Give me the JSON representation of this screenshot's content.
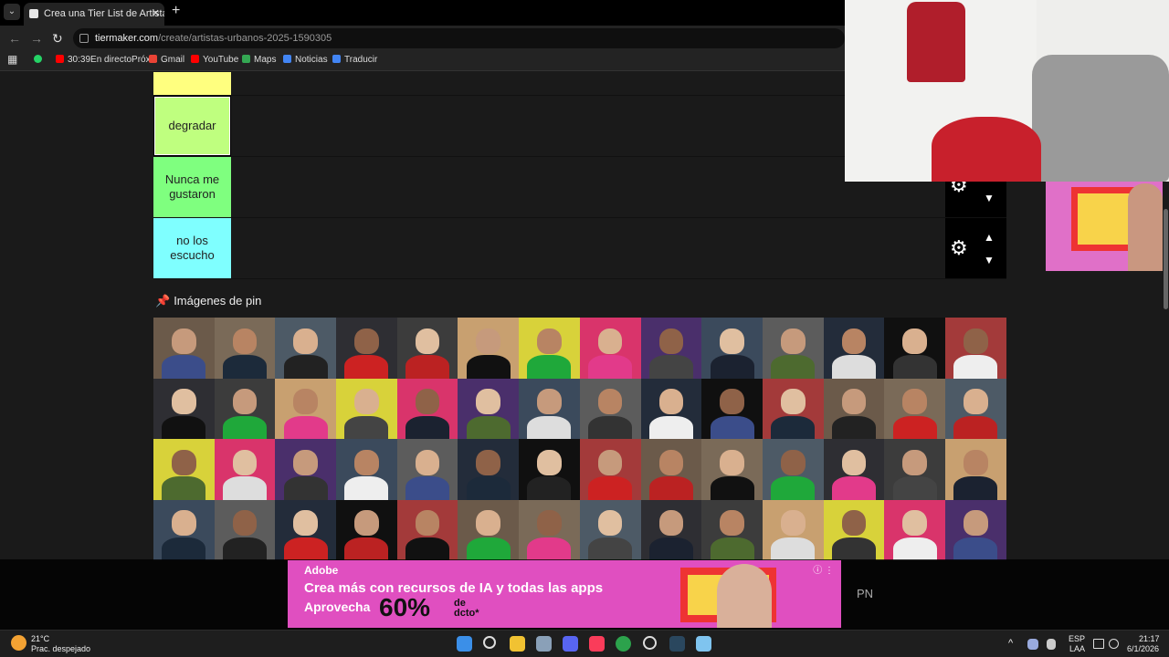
{
  "browser": {
    "tab_title": "Crea una Tier List de Artistas U",
    "tab_close": "✕",
    "new_tab": "+",
    "url_host": "tiermaker.com",
    "url_path": "/create/artistas-urbanos-2025-1590305",
    "bookmarks": [
      {
        "label": "",
        "color": "#25d366",
        "icon": "whatsapp-icon"
      },
      {
        "label": "30:39En directoPróx...",
        "color": "#ff0000",
        "icon": "youtube-icon"
      },
      {
        "label": "Gmail",
        "color": "#ea4335",
        "icon": "gmail-icon"
      },
      {
        "label": "YouTube",
        "color": "#ff0000",
        "icon": "youtube-icon"
      },
      {
        "label": "Maps",
        "color": "#34a853",
        "icon": "maps-icon"
      },
      {
        "label": "Noticias",
        "color": "#4285f4",
        "icon": "news-icon"
      },
      {
        "label": "Traducir",
        "color": "#4285f4",
        "icon": "translate-icon"
      }
    ]
  },
  "tiers": [
    {
      "label": "",
      "color": "#ffff7f"
    },
    {
      "label": "degradar",
      "color": "#bfff7f"
    },
    {
      "label": "Nunca me gustaron",
      "color": "#7fff7f"
    },
    {
      "label": "no los escucho",
      "color": "#7fffff"
    }
  ],
  "pin_section": {
    "title": "Imágenes de pin",
    "icon": "pin-icon"
  },
  "pin_grid": {
    "rows": 4,
    "columns": 14,
    "count": 56
  },
  "ad": {
    "brand": "Adobe",
    "line1": "Crea más con recursos de IA y todas las apps",
    "line2": "Aprovecha",
    "discount": "60%",
    "discount_suffix": "de dcto*"
  },
  "overlay_text": "PN",
  "taskbar": {
    "weather_temp": "21°C",
    "weather_desc": "Prac. despejado",
    "lang1": "ESP",
    "lang2": "LAA",
    "time": "21:17",
    "date": "6/1/2026"
  }
}
